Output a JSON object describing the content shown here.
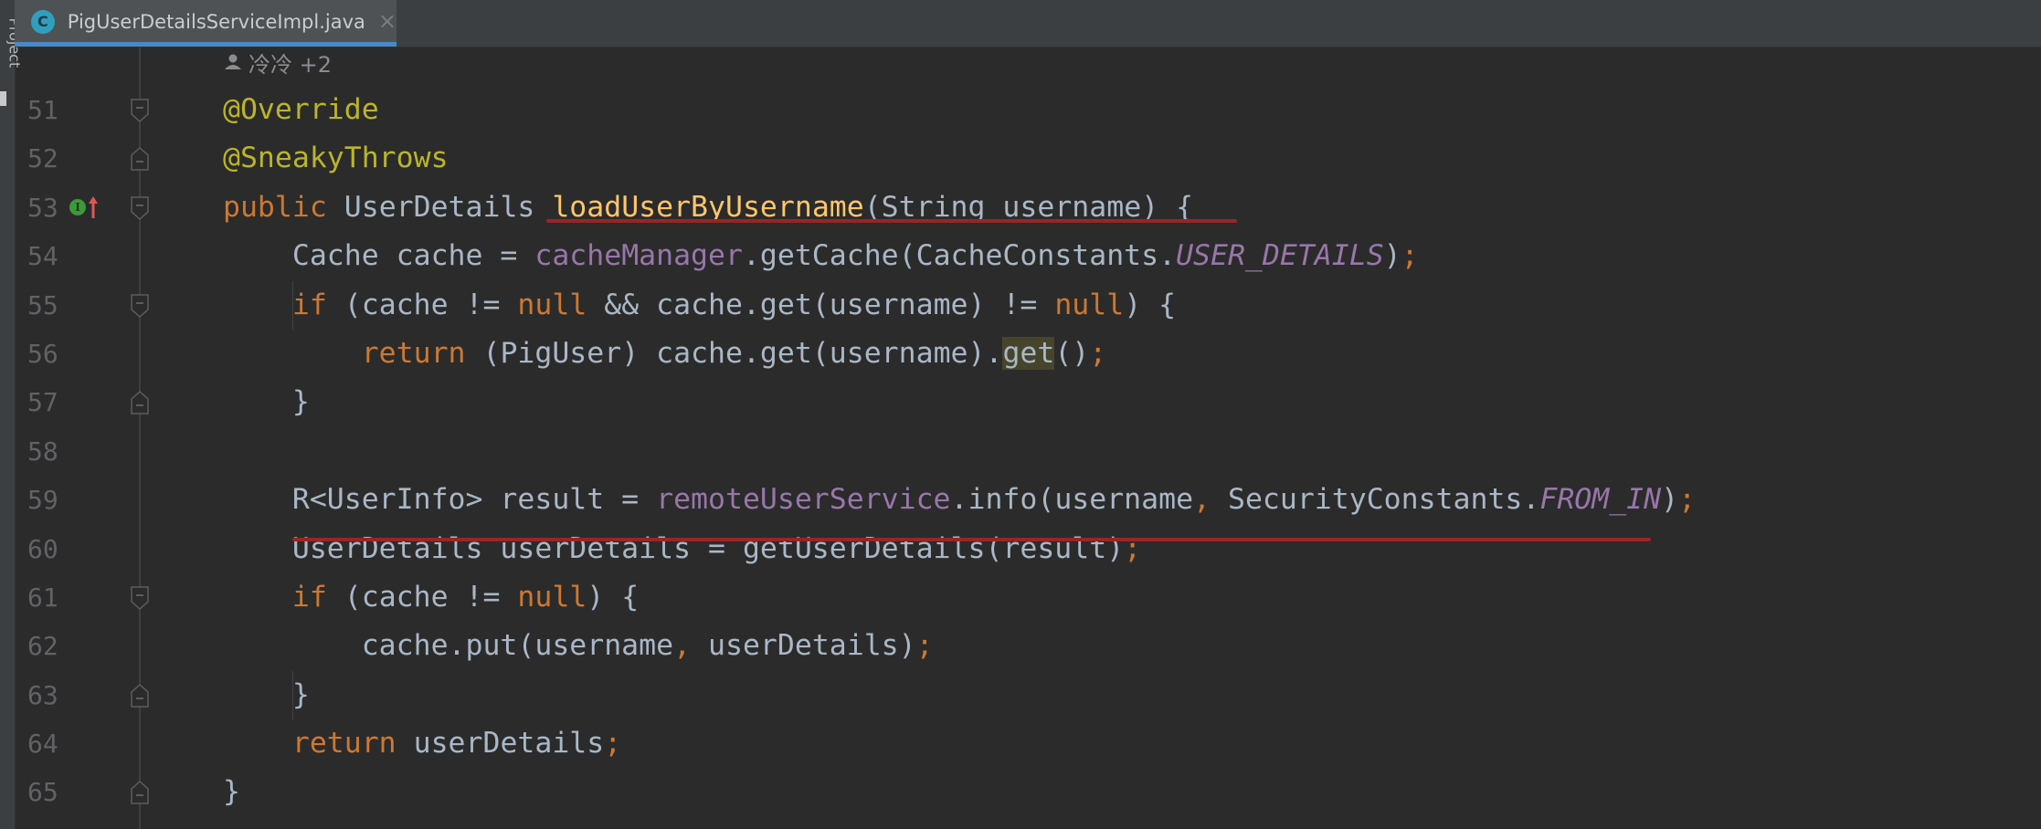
{
  "sidebar": {
    "project_label": "Project"
  },
  "tab": {
    "filename": "PigUserDetailsServiceImpl.java",
    "icon": "C",
    "close": "×"
  },
  "author": {
    "names": "冷冷 +2"
  },
  "colors": {
    "keyword": "#cc7832",
    "annotation": "#bbb529",
    "text": "#a9b7c6",
    "field": "#9876aa",
    "background": "#2b2b2b",
    "underline": "#9b2424",
    "accent": "#4a88c7"
  },
  "lines": [
    {
      "n": "51",
      "fold": "start",
      "tokens": [
        [
          "@Override",
          "a"
        ]
      ]
    },
    {
      "n": "52",
      "fold": "end",
      "tokens": [
        [
          "@SneakyThrows",
          "a"
        ]
      ]
    },
    {
      "n": "53",
      "fold": "start",
      "icons": [
        "implements-icon",
        "override-up-arrow-icon"
      ],
      "tokens": [
        [
          "public ",
          "k"
        ],
        [
          "UserDetails ",
          "d"
        ],
        [
          "loadUserByUsername",
          "m"
        ],
        [
          "(String username) {",
          "d"
        ]
      ]
    },
    {
      "n": "54",
      "tokens": [
        [
          "    Cache cache = ",
          "d"
        ],
        [
          "cacheManager",
          "f"
        ],
        [
          ".getCache(CacheConstants.",
          "d"
        ],
        [
          "USER_DETAILS",
          "fi"
        ],
        [
          ")",
          "d"
        ],
        [
          ";",
          "k"
        ]
      ]
    },
    {
      "n": "55",
      "fold": "start",
      "tokens": [
        [
          "    ",
          "d"
        ],
        [
          "if ",
          "k"
        ],
        [
          "(cache != ",
          "d"
        ],
        [
          "null ",
          "k"
        ],
        [
          "&& cache.get(username) != ",
          "d"
        ],
        [
          "null",
          "k"
        ],
        [
          ") {",
          "d"
        ]
      ]
    },
    {
      "n": "56",
      "tokens": [
        [
          "        ",
          "d"
        ],
        [
          "return ",
          "k"
        ],
        [
          "(PigUser) cache.get(username).",
          "d"
        ],
        [
          "get",
          "hl"
        ],
        [
          "()",
          "d"
        ],
        [
          ";",
          "k"
        ]
      ]
    },
    {
      "n": "57",
      "fold": "end",
      "tokens": [
        [
          "    }",
          "d"
        ]
      ]
    },
    {
      "n": "58",
      "tokens": []
    },
    {
      "n": "59",
      "tokens": [
        [
          "    R<UserInfo> result = ",
          "d"
        ],
        [
          "remoteUserService",
          "f"
        ],
        [
          ".info(username",
          "d"
        ],
        [
          ", ",
          "k"
        ],
        [
          "SecurityConstants.",
          "d"
        ],
        [
          "FROM_IN",
          "fi"
        ],
        [
          ")",
          "d"
        ],
        [
          ";",
          "k"
        ]
      ]
    },
    {
      "n": "60",
      "tokens": [
        [
          "    UserDetails userDetails = getUserDetails(result)",
          "d"
        ],
        [
          ";",
          "k"
        ]
      ]
    },
    {
      "n": "61",
      "fold": "start",
      "tokens": [
        [
          "    ",
          "d"
        ],
        [
          "if ",
          "k"
        ],
        [
          "(cache != ",
          "d"
        ],
        [
          "null",
          "k"
        ],
        [
          ") {",
          "d"
        ]
      ]
    },
    {
      "n": "62",
      "tokens": [
        [
          "        cache.put(username",
          "d"
        ],
        [
          ", ",
          "k"
        ],
        [
          "userDetails)",
          "d"
        ],
        [
          ";",
          "k"
        ]
      ]
    },
    {
      "n": "63",
      "fold": "end",
      "tokens": [
        [
          "    }",
          "d"
        ]
      ]
    },
    {
      "n": "64",
      "tokens": [
        [
          "    ",
          "d"
        ],
        [
          "return ",
          "k"
        ],
        [
          "userDetails",
          "d"
        ],
        [
          ";",
          "k"
        ]
      ]
    },
    {
      "n": "65",
      "fold": "end",
      "tokens": [
        [
          "}",
          "d"
        ]
      ]
    }
  ]
}
